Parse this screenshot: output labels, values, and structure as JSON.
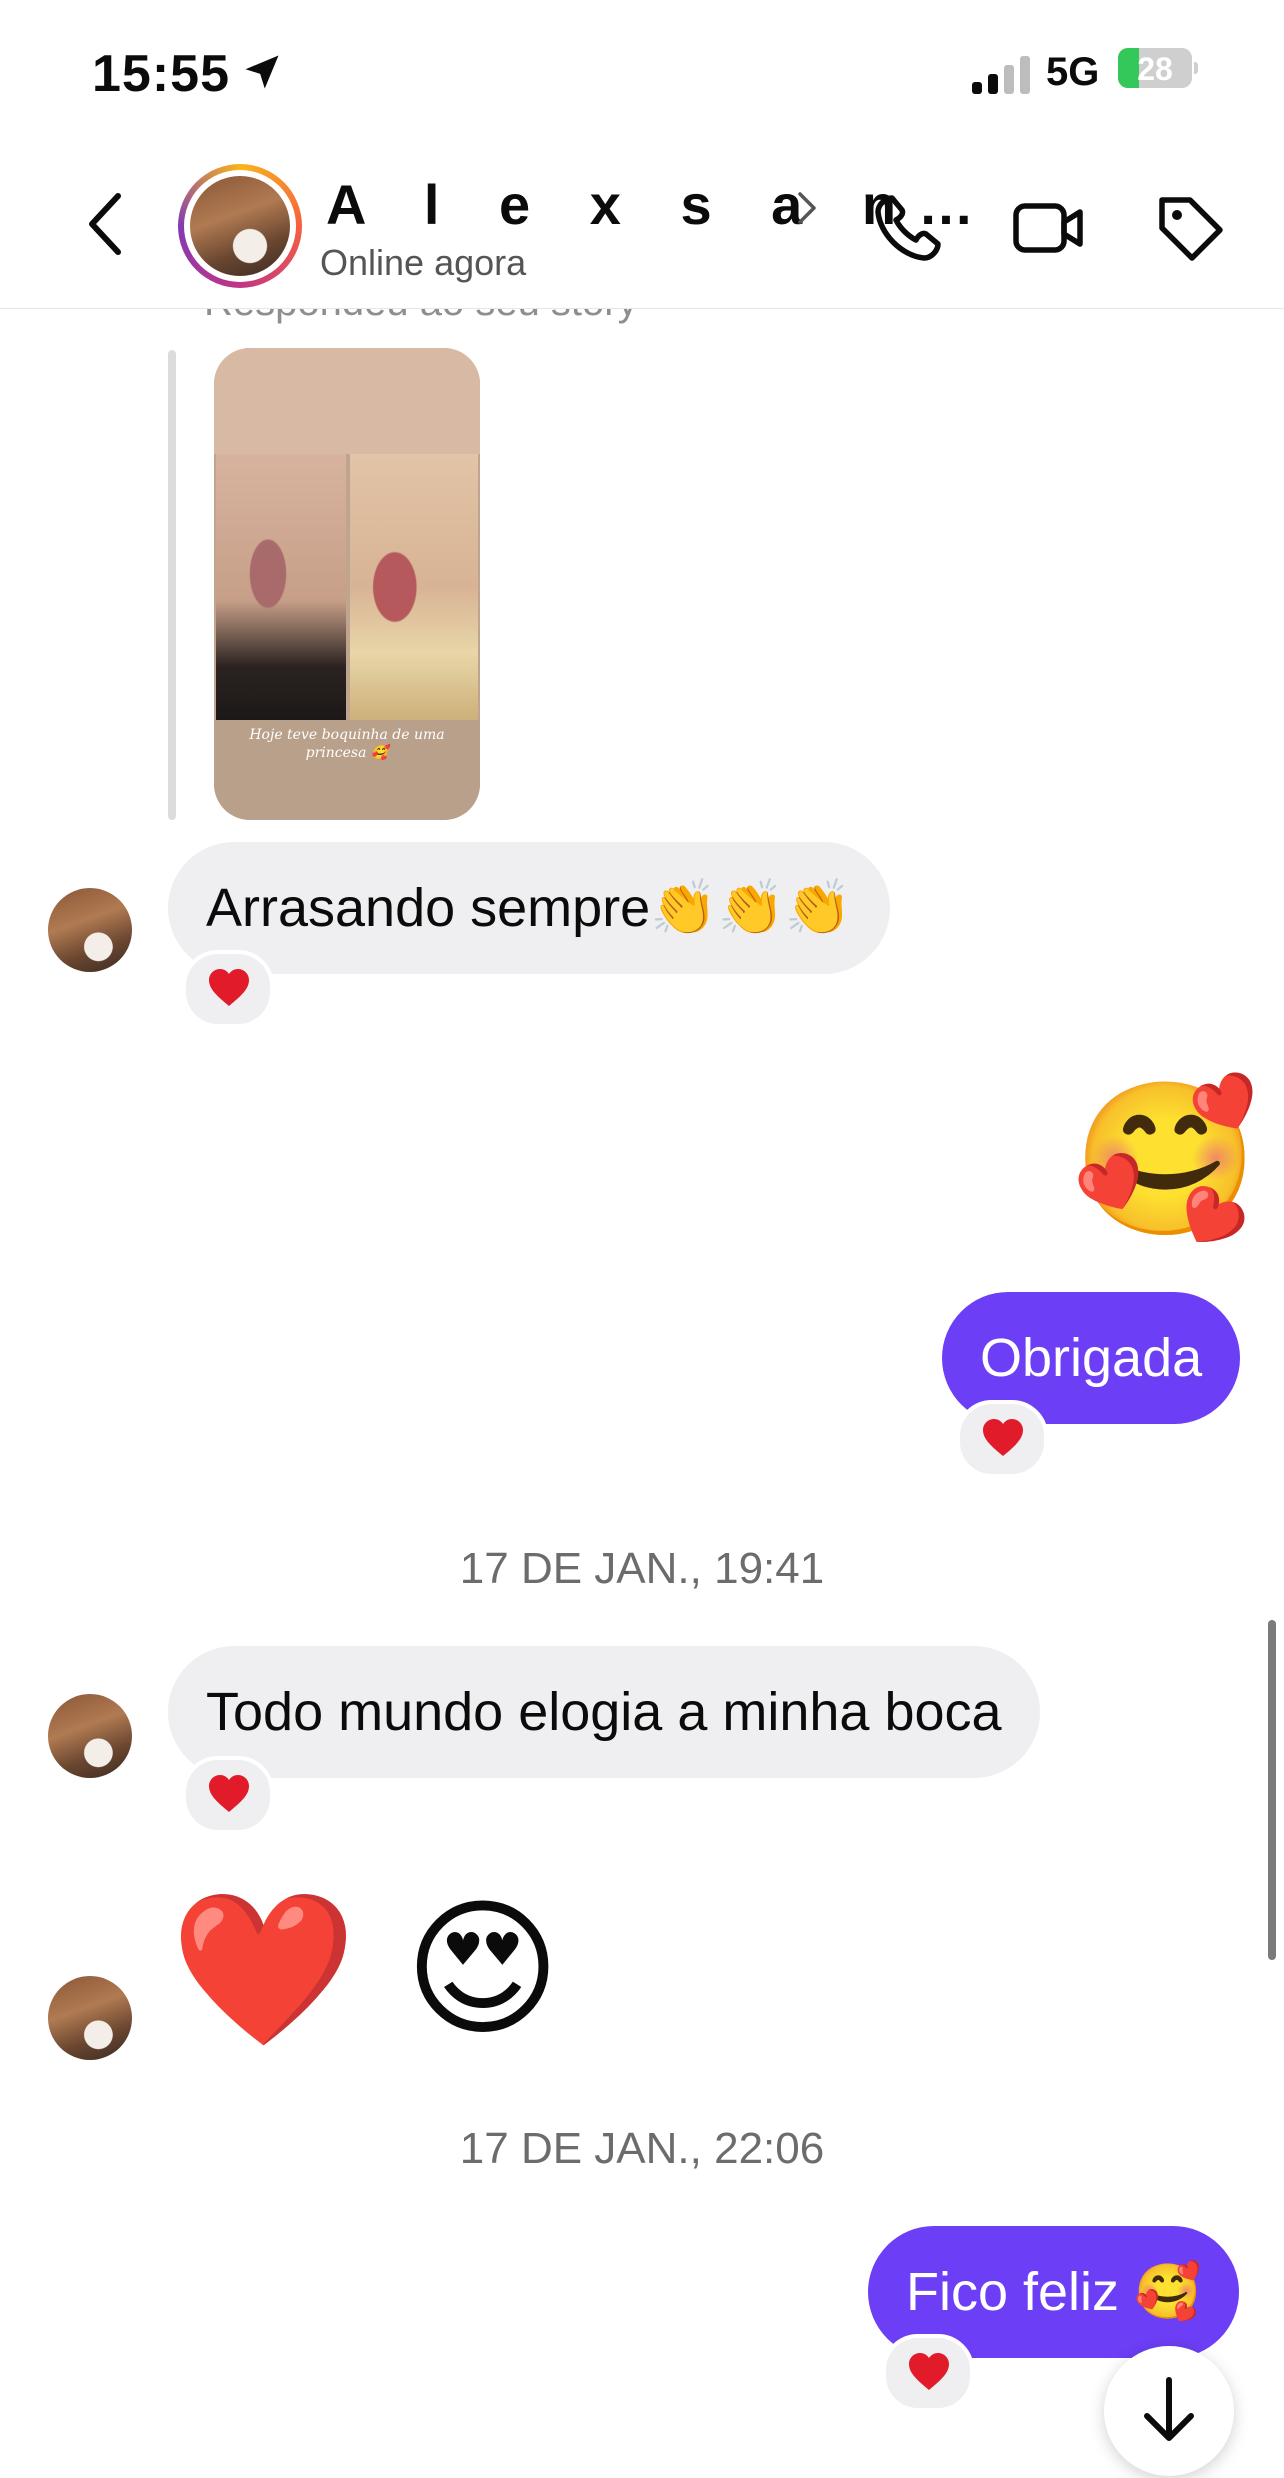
{
  "status_bar": {
    "time": "15:55",
    "network": "5G",
    "battery": "28",
    "battery_level": 0.28
  },
  "header": {
    "name": "A l e x s a n…",
    "subtitle": "Online agora"
  },
  "chat": {
    "reply_label": "Respondeu ao seu story",
    "story_caption": "Hoje teve boquinha de uma princesa 🥰",
    "messages": [
      {
        "text": "Arrasando sempre👏👏👏"
      },
      {
        "emoji": "🥰"
      },
      {
        "text": "Obrigada"
      },
      {
        "date": "17 DE JAN., 19:41"
      },
      {
        "text": "Todo mundo elogia a minha boca"
      },
      {
        "emoji": "❤️ 😍"
      },
      {
        "date": "17 DE JAN., 22:06"
      },
      {
        "text": "Fico feliz 🥰"
      }
    ]
  }
}
